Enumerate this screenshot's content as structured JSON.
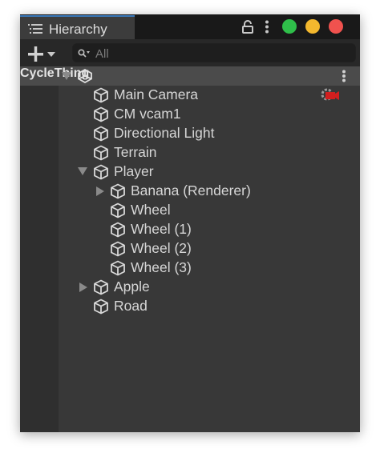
{
  "tab": {
    "title": "Hierarchy",
    "icon": "list-icon"
  },
  "window_controls": {
    "green": "#2fbf4a",
    "yellow": "#f4b82e",
    "red": "#f0524e"
  },
  "toolbar": {
    "add_symbol": "+",
    "search_placeholder": "All"
  },
  "scene": {
    "name": "CycleThing",
    "icon": "unity-icon",
    "expanded": true
  },
  "items": [
    {
      "label": "Main Camera",
      "depth": 0,
      "arrow": "none",
      "badge": "camera-warning-icon"
    },
    {
      "label": "CM vcam1",
      "depth": 0,
      "arrow": "none"
    },
    {
      "label": "Directional Light",
      "depth": 0,
      "arrow": "none"
    },
    {
      "label": "Terrain",
      "depth": 0,
      "arrow": "none"
    },
    {
      "label": "Player",
      "depth": 0,
      "arrow": "down"
    },
    {
      "label": "Banana (Renderer)",
      "depth": 1,
      "arrow": "right"
    },
    {
      "label": "Wheel",
      "depth": 1,
      "arrow": "none"
    },
    {
      "label": "Wheel (1)",
      "depth": 1,
      "arrow": "none"
    },
    {
      "label": "Wheel (2)",
      "depth": 1,
      "arrow": "none"
    },
    {
      "label": "Wheel (3)",
      "depth": 1,
      "arrow": "none"
    },
    {
      "label": "Apple",
      "depth": 0,
      "arrow": "right"
    },
    {
      "label": "Road",
      "depth": 0,
      "arrow": "none"
    }
  ],
  "colors": {
    "accent": "#3a79bb",
    "panel": "#383838",
    "text": "#d6d6d6",
    "badge": "#d21f1f"
  }
}
